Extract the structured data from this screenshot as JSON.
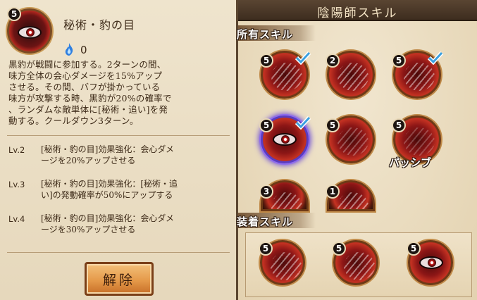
{
  "colors": {
    "panel_bg": "#efe4cd",
    "text_dark": "#3d2a18",
    "skill_red": "#b5281f",
    "check_blue": "#3aa0e0",
    "button_orange": "#e59a4a",
    "title_bar": "#4a3626"
  },
  "detail": {
    "level": "5",
    "title": "秘術・豹の目",
    "cost_icon": "blue-flame-icon",
    "cost": "0",
    "description": [
      "黒豹が戦闘に参加する。2ターンの間、",
      "味方全体の会心ダメージを15%アップ",
      "させる。その間、バフが掛かっている",
      "味方が攻撃する時、黒豹が20%の確率で",
      "、ランダムな敵単体に[秘術・追い]を発",
      "動する。クールダウン3ターン。"
    ],
    "levels": [
      {
        "label": "Lv.2",
        "lines": [
          "[秘術・豹の目]効果強化：会心ダメ",
          "ージを20%アップさせる"
        ]
      },
      {
        "label": "Lv.3",
        "lines": [
          "[秘術・豹の目]効果強化：[秘術・追",
          "い]の発動確率が50%にアップする"
        ]
      },
      {
        "label": "Lv.4",
        "lines": [
          "[秘術・豹の目]効果強化：会心ダメ",
          "ージを30%アップさせる"
        ]
      }
    ],
    "release_button": "解除"
  },
  "panel": {
    "title": "陰陽師スキル",
    "owned_section": "所有スキル",
    "equipped_section": "装着スキル",
    "passive_tag": "パッシブ",
    "owned": [
      {
        "level": "5",
        "checked": true,
        "icon": "claw-slash-icon"
      },
      {
        "level": "2",
        "checked": false,
        "icon": "claw-slash-icon"
      },
      {
        "level": "5",
        "checked": true,
        "icon": "claw-slash-icon"
      },
      {
        "level": "5",
        "checked": true,
        "icon": "leopard-eye-icon"
      },
      {
        "level": "5",
        "checked": false,
        "icon": "claw-slash-icon"
      },
      {
        "level": "5",
        "checked": false,
        "icon": "beast-icon"
      },
      {
        "level": "3",
        "checked": false,
        "icon": "claw-slash-icon"
      },
      {
        "level": "1",
        "checked": false,
        "icon": "claw-slash-icon"
      }
    ],
    "equipped": [
      {
        "level": "5",
        "icon": "claw-slash-icon"
      },
      {
        "level": "5",
        "icon": "claw-slash-icon"
      },
      {
        "level": "5",
        "icon": "leopard-eye-icon"
      }
    ]
  }
}
